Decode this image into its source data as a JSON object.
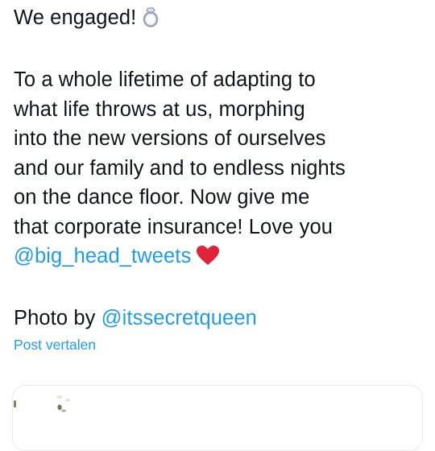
{
  "tweet": {
    "line1": "We engaged!",
    "line1_emoji": "ring-icon",
    "body_lines": [
      "To a whole lifetime of adapting to",
      "what life throws at us, morphing",
      "into the new versions of ourselves",
      "and our family and to endless nights",
      "on the dance floor. Now give me",
      "that corporate insurance! Love you"
    ],
    "mention_partner": "@big_head_tweets",
    "mention_partner_emoji": "red-heart-icon",
    "photo_credit_prefix": "Photo by",
    "mention_photographer": "@itssecretqueen"
  },
  "translate_label": "Post vertalen",
  "colors": {
    "text": "#0f1419",
    "link": "#1d9bf0",
    "heart": "#e0223b",
    "card_border": "#e6ecf0"
  }
}
